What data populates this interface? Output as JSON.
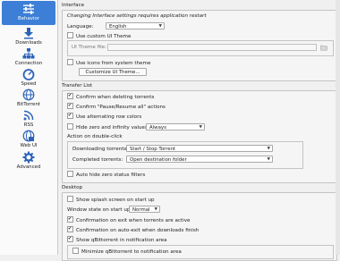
{
  "sidebar": {
    "items": [
      {
        "label": "Behavior",
        "icon": "sliders-icon"
      },
      {
        "label": "Downloads",
        "icon": "downloads-icon"
      },
      {
        "label": "Connection",
        "icon": "network-icon"
      },
      {
        "label": "Speed",
        "icon": "speedometer-icon"
      },
      {
        "label": "BitTorrent",
        "icon": "globe-icon"
      },
      {
        "label": "RSS",
        "icon": "rss-icon"
      },
      {
        "label": "Web UI",
        "icon": "web-ui-icon"
      },
      {
        "label": "Advanced",
        "icon": "gear-icon"
      }
    ],
    "active_index": 0,
    "accent": "#3d7fd6"
  },
  "interface": {
    "title": "Interface",
    "note": "Changing Interface settings requires application restart",
    "language_label": "Language:",
    "language_value": "English",
    "use_custom_theme": "Use custom UI Theme",
    "theme_file_label": "UI Theme file:",
    "use_system_icons": "Use icons from system theme",
    "customize_button": "Customize UI Theme..."
  },
  "transfer_list": {
    "title": "Transfer List",
    "confirm_delete": "Confirm when deleting torrents",
    "confirm_pause": "Confirm \"Pause/Resume all\" actions",
    "alternating_rows": "Use alternating row colors",
    "hide_zero_label": "Hide zero and infinity values",
    "hide_zero_value": "Always",
    "double_click_title": "Action on double-click",
    "downloading_label": "Downloading torrents:",
    "downloading_value": "Start / Stop Torrent",
    "completed_label": "Completed torrents:",
    "completed_value": "Open destination folder",
    "auto_hide_zero": "Auto hide zero status filters"
  },
  "desktop": {
    "title": "Desktop",
    "splash": "Show splash screen on start up",
    "window_state_label": "Window state on start up:",
    "window_state_value": "Normal",
    "confirm_exit_active": "Confirmation on exit when torrents are active",
    "confirm_auto_exit": "Confirmation on auto-exit when downloads finish",
    "show_tray": "Show qBittorrent in notification area",
    "minimize_tray": "Minimize qBittorrent to notification area"
  }
}
